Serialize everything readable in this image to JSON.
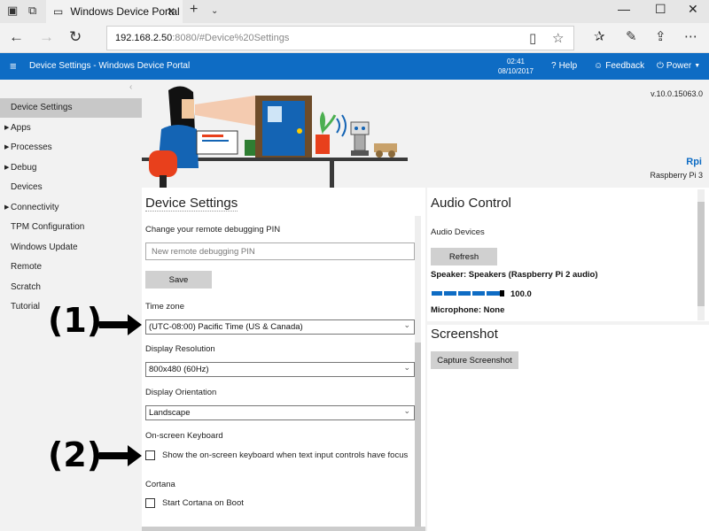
{
  "browser": {
    "tab_title": "Windows Device Portal",
    "address_host": "192.168.2.50",
    "address_path": ":8080/#Device%20Settings"
  },
  "header": {
    "title": "Device Settings - Windows Device Portal",
    "time": "02:41",
    "date": "08/10/2017",
    "help": "Help",
    "feedback": "Feedback",
    "power": "Power"
  },
  "sidebar": {
    "items": [
      {
        "label": "Device Settings",
        "expandable": false,
        "active": true
      },
      {
        "label": "Apps",
        "expandable": true
      },
      {
        "label": "Processes",
        "expandable": true
      },
      {
        "label": "Debug",
        "expandable": true
      },
      {
        "label": "Devices",
        "expandable": false
      },
      {
        "label": "Connectivity",
        "expandable": true
      },
      {
        "label": "TPM Configuration",
        "expandable": false
      },
      {
        "label": "Windows Update",
        "expandable": false
      },
      {
        "label": "Remote",
        "expandable": false
      },
      {
        "label": "Scratch",
        "expandable": false
      },
      {
        "label": "Tutorial",
        "expandable": false
      }
    ]
  },
  "banner": {
    "version": "v.10.0.15063.0",
    "device_name": "Rpi",
    "device_model": "Raspberry Pi 3"
  },
  "device_settings": {
    "title": "Device Settings",
    "pin_label": "Change your remote debugging PIN",
    "pin_placeholder": "New remote debugging PIN",
    "save": "Save",
    "timezone_label": "Time zone",
    "timezone_value": "(UTC-08:00) Pacific Time (US & Canada)",
    "resolution_label": "Display Resolution",
    "resolution_value": "800x480 (60Hz)",
    "orientation_label": "Display Orientation",
    "orientation_value": "Landscape",
    "keyboard_label": "On-screen Keyboard",
    "keyboard_checkbox": "Show the on-screen keyboard when text input controls have focus",
    "keyboard_checked": false,
    "cortana_label": "Cortana",
    "cortana_checkbox": "Start Cortana on Boot",
    "cortana_checked": false
  },
  "audio": {
    "title": "Audio Control",
    "devices_label": "Audio Devices",
    "refresh": "Refresh",
    "speaker": "Speaker: Speakers (Raspberry Pi 2 audio)",
    "volume": "100.0",
    "microphone": "Microphone: None"
  },
  "screenshot": {
    "title": "Screenshot",
    "capture": "Capture Screenshot"
  },
  "annotations": {
    "one": "(1)",
    "two": "(2)"
  }
}
